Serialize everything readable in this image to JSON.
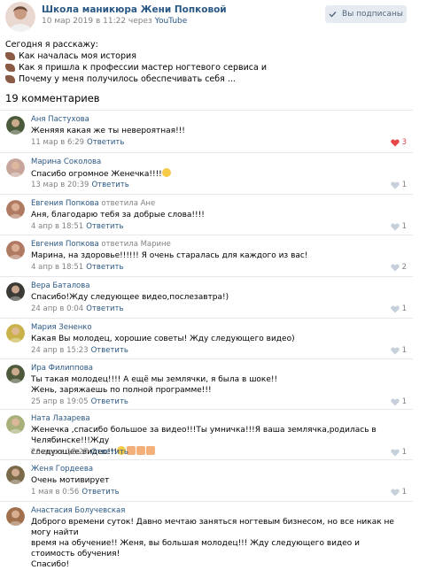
{
  "header": {
    "channel_name": "Школа маникюра Жени Попковой",
    "date": "10 мар 2019 в 11:22 через ",
    "via": "YouTube",
    "subscribe_label": "Вы подписаны"
  },
  "description": {
    "intro": "Сегодня я расскажу:",
    "items": [
      "Как началась моя история",
      "Как я пришла к профессии мастер ногтевого сервиса и",
      "Почему у меня получилось обеспечивать себя ..."
    ]
  },
  "comments_count": "19 комментариев",
  "reply_label": "Ответить",
  "comments": [
    {
      "author": "Аня Пастухова",
      "reply_to": "",
      "text": [
        "Женяяя какая же ты невероятная!!!"
      ],
      "time": "11 мар в 6:29",
      "likes": "3",
      "liked": true,
      "avatar_color": "#4b5a3a"
    },
    {
      "author": "Марина Соколова",
      "reply_to": "",
      "text": [
        "Спасибо огромное Женечка!!!!"
      ],
      "time": "13 мар в 20:39",
      "likes": "1",
      "liked": false,
      "avatar_color": "#c7a59a",
      "emoji": true
    },
    {
      "author": "Евгения Попкова",
      "reply_to": "ответила Ане",
      "text": [
        "Аня, благодарю тебя за добрые слова!!!!"
      ],
      "time": "4 апр в 18:51",
      "likes": "1",
      "liked": false,
      "avatar_color": "#b07a62"
    },
    {
      "author": "Евгения Попкова",
      "reply_to": "ответила Марине",
      "text": [
        "Марина, на здоровье!!!!!! Я очень старалась для каждого из вас!"
      ],
      "time": "4 апр в 18:51",
      "likes": "2",
      "liked": false,
      "avatar_color": "#b07a62"
    },
    {
      "author": "Вера Баталова",
      "reply_to": "",
      "text": [
        "Спасибо!Жду следующее видео,послезавтра!)"
      ],
      "time": "24 апр в 0:04",
      "likes": "1",
      "liked": false,
      "avatar_color": "#3c3a34"
    },
    {
      "author": "Мария Зененко",
      "reply_to": "",
      "text": [
        "Какая Вы молодец, хорошие советы! Жду следующего видео)"
      ],
      "time": "24 апр в 15:23",
      "likes": "1",
      "liked": false,
      "avatar_color": "#c9b24a"
    },
    {
      "author": "Ира Филиппова",
      "reply_to": "",
      "text": [
        "Ты такая молодец!!!! А ещё мы землячки, я была в шоке!!",
        "Жень, заряжаешь по полной программе!!!"
      ],
      "time": "25 апр в 19:05",
      "likes": "1",
      "liked": false,
      "avatar_color": "#4e5a3c",
      "emoji_inline": true
    },
    {
      "author": "Ната Лазарева",
      "reply_to": "",
      "text": [
        "Женечка ,спасибо большое за видео!!!Ты умничка!!!Я ваша землячка,родилась в Челябинске!!!Жду",
        "следующее видео!!!"
      ],
      "time": "26 апр в 12:27",
      "likes": "1",
      "liked": false,
      "avatar_color": "#a9b07a",
      "hands": true
    },
    {
      "author": "Женя Гордеева",
      "reply_to": "",
      "text": [
        "Очень мотивирует"
      ],
      "time": "1 мая в 0:56",
      "likes": "1",
      "liked": false,
      "avatar_color": "#7a6a4a"
    },
    {
      "author": "Анастасия Болучевская",
      "reply_to": "",
      "text": [
        "Доброго времени суток! Давно мечтаю заняться ногтевым бизнесом, но все никак не могу найти",
        "время на обучение!! Женя, вы большая   молодец!!! Жду следующего видео и стоимость обучения!",
        "Спасибо!"
      ],
      "time": "",
      "likes": "",
      "liked": false,
      "avatar_color": "#a0704c"
    }
  ]
}
